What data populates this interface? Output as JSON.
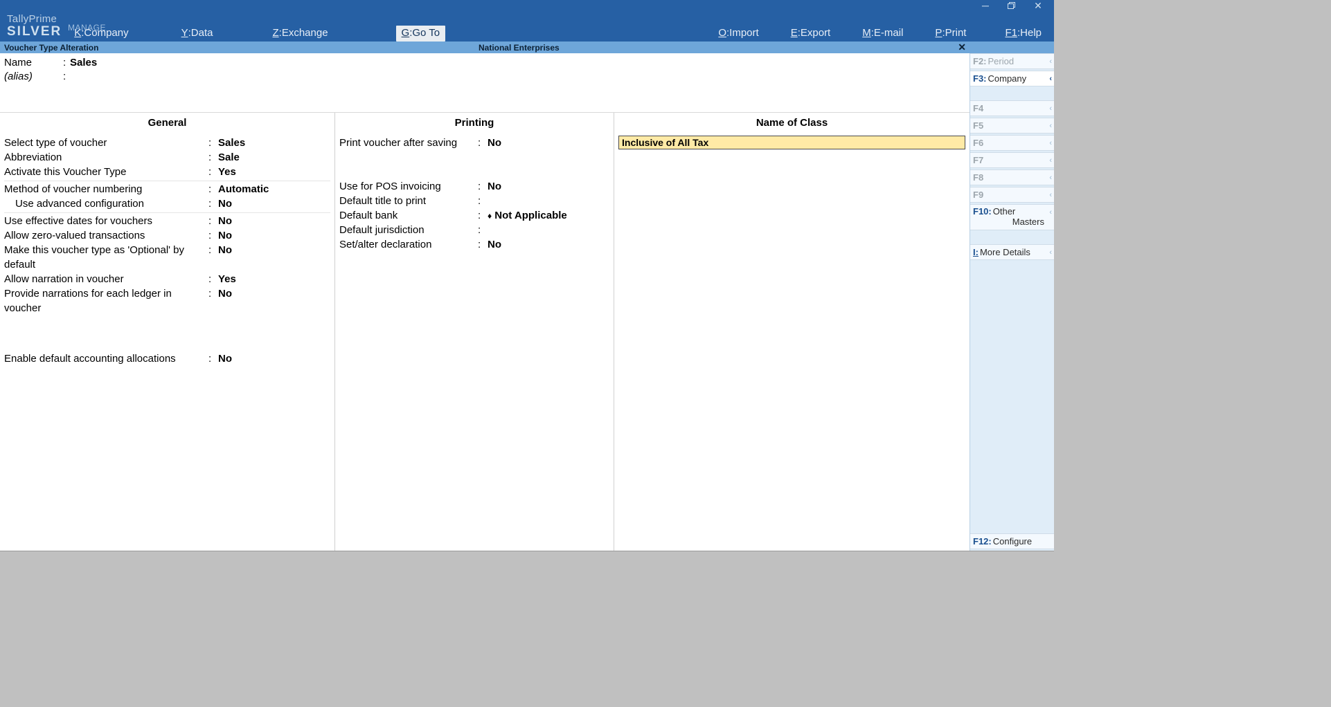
{
  "brand": {
    "line1": "TallyPrime",
    "line2": "SILVER",
    "manage": "MANAGE"
  },
  "menu": {
    "company": {
      "key": "K",
      "label": "Company"
    },
    "data": {
      "key": "Y",
      "label": "Data"
    },
    "exchange": {
      "key": "Z",
      "label": "Exchange"
    },
    "goto": {
      "key": "G",
      "label": "Go To"
    },
    "import": {
      "key": "O",
      "label": "Import"
    },
    "export": {
      "key": "E",
      "label": "Export"
    },
    "email": {
      "key": "M",
      "label": "E-mail"
    },
    "print": {
      "key": "P",
      "label": "Print"
    },
    "help": {
      "key": "F1",
      "label": "Help"
    }
  },
  "bluebar": {
    "title": "Voucher Type Alteration",
    "company": "National Enterprises"
  },
  "header": {
    "name_label": "Name",
    "name_value": "Sales",
    "alias_label": "(alias)"
  },
  "general": {
    "title": "General",
    "rows": {
      "voucher_type": {
        "label": "Select type of voucher",
        "value": "Sales"
      },
      "abbrev": {
        "label": "Abbreviation",
        "value": "Sale"
      },
      "activate": {
        "label": "Activate this Voucher Type",
        "value": "Yes"
      },
      "numbering": {
        "label": "Method of voucher numbering",
        "value": "Automatic"
      },
      "adv_config": {
        "label": "Use advanced configuration",
        "value": "No"
      },
      "eff_dates": {
        "label": "Use effective dates for vouchers",
        "value": "No"
      },
      "zero_val": {
        "label": "Allow zero-valued transactions",
        "value": "No"
      },
      "optional": {
        "label": "Make this voucher type as 'Optional' by default",
        "value": "No"
      },
      "narration": {
        "label": "Allow narration in voucher",
        "value": "Yes"
      },
      "narr_each": {
        "label": "Provide narrations for each ledger in voucher",
        "value": "No"
      },
      "def_alloc": {
        "label": "Enable default accounting allocations",
        "value": "No"
      }
    }
  },
  "printing": {
    "title": "Printing",
    "rows": {
      "print_after": {
        "label": "Print voucher after saving",
        "value": "No"
      },
      "pos": {
        "label": "Use for POS invoicing",
        "value": "No"
      },
      "def_title": {
        "label": "Default title to print",
        "value": ""
      },
      "def_bank": {
        "label": "Default bank",
        "value": "Not Applicable"
      },
      "def_juris": {
        "label": "Default jurisdiction",
        "value": ""
      },
      "set_decl": {
        "label": "Set/alter declaration",
        "value": "No"
      }
    }
  },
  "class": {
    "title": "Name of Class",
    "value": "Inclusive of All Tax"
  },
  "right": {
    "f2": {
      "key": "F2:",
      "label": "Period"
    },
    "f3": {
      "key": "F3:",
      "label": "Company"
    },
    "f4": {
      "key": "F4",
      "label": ""
    },
    "f5": {
      "key": "F5",
      "label": ""
    },
    "f6": {
      "key": "F6",
      "label": ""
    },
    "f7": {
      "key": "F7",
      "label": ""
    },
    "f8": {
      "key": "F8",
      "label": ""
    },
    "f9": {
      "key": "F9",
      "label": ""
    },
    "f10": {
      "key": "F10:",
      "label1": "Other",
      "label2": "Masters"
    },
    "more": {
      "key": "I:",
      "label": "More Details"
    },
    "f12": {
      "key": "F12:",
      "label": "Configure"
    }
  }
}
